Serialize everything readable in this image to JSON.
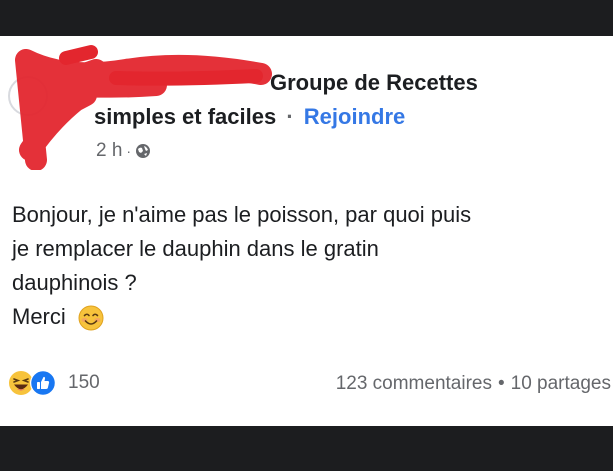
{
  "group": {
    "name_line1": "Groupe de Recettes",
    "name_line2": "simples et faciles",
    "join_label": "Rejoindre",
    "separator": "·"
  },
  "meta": {
    "time": "2 h",
    "dot": "·",
    "privacy_icon": "globe-icon"
  },
  "post": {
    "lines": [
      "Bonjour, je n'aime pas le poisson, par quoi puis",
      "je remplacer le dauphin dans le gratin",
      "dauphinois ?"
    ],
    "closing": "Merci",
    "closing_emoji": "smiling-face-icon"
  },
  "engagement": {
    "reaction_icons": [
      "laughing-face-icon",
      "like-icon"
    ],
    "reaction_count": "150",
    "comments": "123 commentaires",
    "dot": "•",
    "shares": "10 partages"
  },
  "colors": {
    "link_blue": "#3578e5",
    "secondary_text": "#65676b",
    "redaction_red": "#e3262e",
    "dark_frame": "#1c1d1f"
  }
}
